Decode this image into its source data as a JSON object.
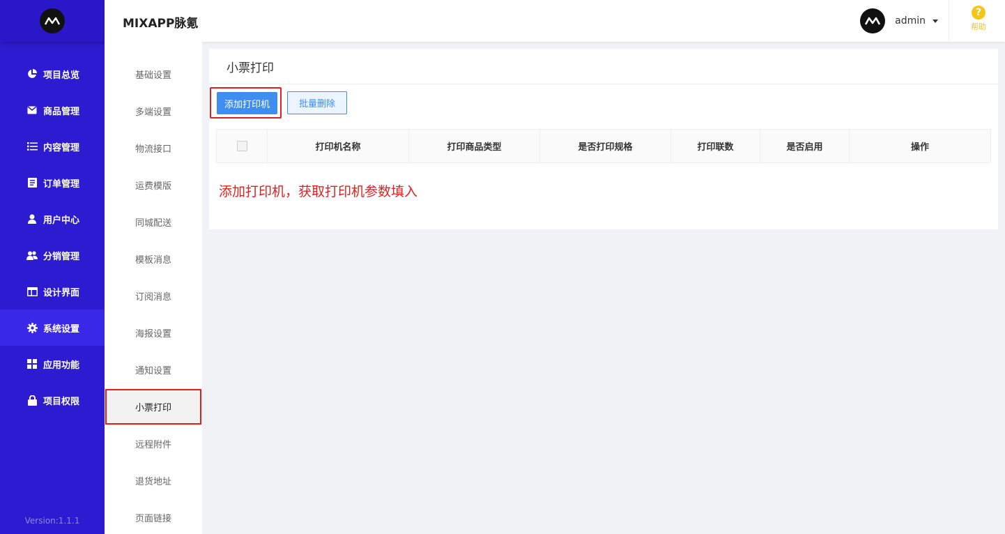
{
  "sidebar": {
    "logo": "mixapp-logo",
    "items": [
      {
        "label": "项目总览",
        "icon": "pie-chart-icon"
      },
      {
        "label": "商品管理",
        "icon": "envelope-icon"
      },
      {
        "label": "内容管理",
        "icon": "list-icon"
      },
      {
        "label": "订单管理",
        "icon": "document-icon"
      },
      {
        "label": "用户中心",
        "icon": "user-icon"
      },
      {
        "label": "分销管理",
        "icon": "users-icon"
      },
      {
        "label": "设计界面",
        "icon": "layout-icon"
      },
      {
        "label": "系统设置",
        "icon": "gear-icon",
        "active": true
      },
      {
        "label": "应用功能",
        "icon": "grid-icon"
      },
      {
        "label": "项目权限",
        "icon": "lock-icon"
      }
    ],
    "version": "Version:1.1.1"
  },
  "header": {
    "title": "MIXAPP脉氪",
    "username": "admin",
    "help_label": "帮助"
  },
  "subnav": {
    "items": [
      "基础设置",
      "多端设置",
      "物流接口",
      "运费模版",
      "同城配送",
      "模板消息",
      "订阅消息",
      "海报设置",
      "通知设置",
      "小票打印",
      "远程附件",
      "退货地址",
      "页面链接"
    ],
    "active": "小票打印"
  },
  "main": {
    "title": "小票打印",
    "add_button": "添加打印机",
    "bulk_delete_button": "批量删除",
    "columns": [
      "打印机名称",
      "打印商品类型",
      "是否打印规格",
      "打印联数",
      "是否启用",
      "操作"
    ],
    "note": "添加打印机，获取打印机参数填入"
  },
  "colors": {
    "sidebar_bg": "#2d1bd1",
    "primary": "#3d8ef0",
    "highlight": "#e02020",
    "help": "#f5c518"
  }
}
